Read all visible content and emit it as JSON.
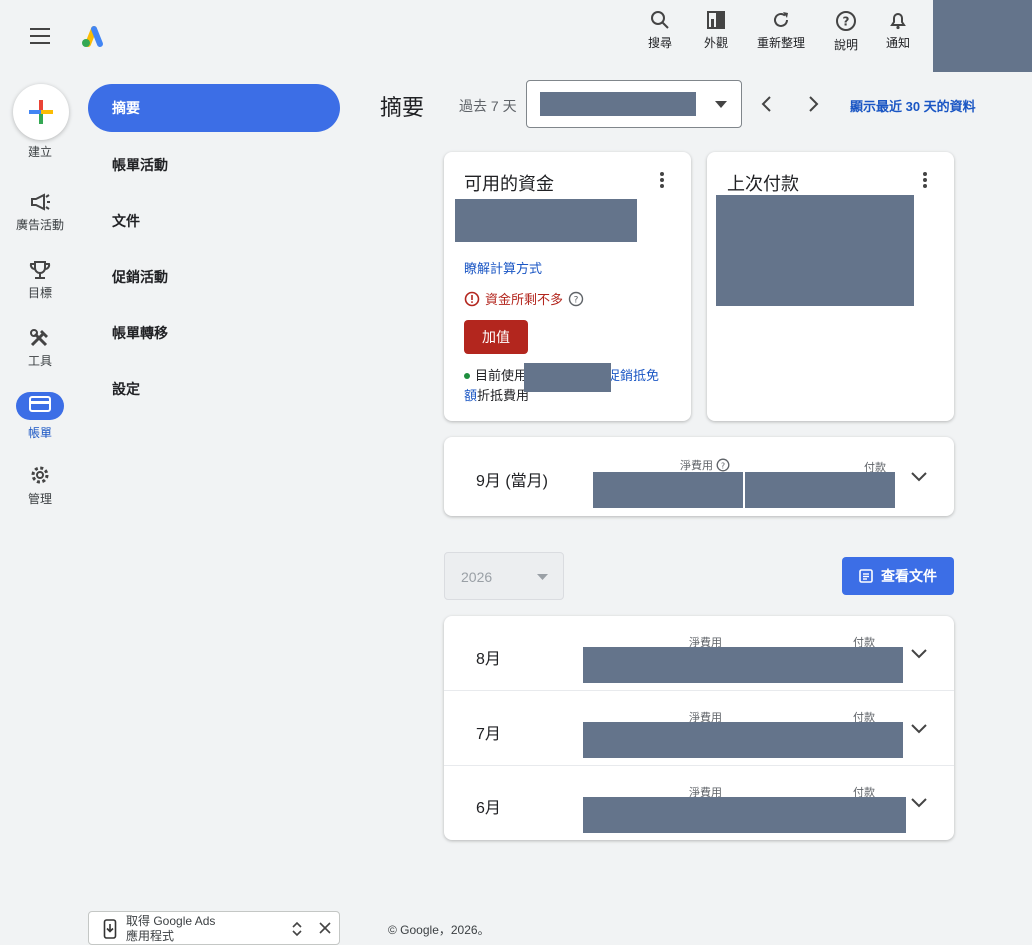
{
  "topbar": {
    "actions": [
      {
        "label": "搜尋",
        "icon": "search-icon"
      },
      {
        "label": "外觀",
        "icon": "appearance-icon"
      },
      {
        "label": "重新整理",
        "icon": "refresh-icon"
      },
      {
        "label": "說明",
        "icon": "help-icon"
      },
      {
        "label": "通知",
        "icon": "bell-icon"
      }
    ]
  },
  "rail": {
    "create": "建立",
    "campaigns": "廣告活動",
    "goals": "目標",
    "tools": "工具",
    "billing": "帳單",
    "admin": "管理"
  },
  "subnav": {
    "items": [
      "摘要",
      "帳單活動",
      "文件",
      "促銷活動",
      "帳單轉移",
      "設定"
    ]
  },
  "header": {
    "title": "摘要",
    "range_label": "過去 7 天",
    "show_30_days": "顯示最近 30 天的資料"
  },
  "funds_card": {
    "title": "可用的資金",
    "learn_link": "瞭解計算方式",
    "warning": "資金所剩不多",
    "add_button": "加值",
    "promo_prefix": "目前使用",
    "promo_link_a": "促銷抵免",
    "promo_link_b": "額",
    "promo_suffix": "折抵費用"
  },
  "last_payment_card": {
    "title": "上次付款"
  },
  "current_month": {
    "label": "9月 (當月)",
    "net_cost_label": "淨費用",
    "payments_label": "付款"
  },
  "year_select": {
    "value": "2026"
  },
  "docs_button": "查看文件",
  "months": [
    {
      "label": "8月",
      "net_cost_label": "淨費用",
      "payments_label": "付款"
    },
    {
      "label": "7月",
      "net_cost_label": "淨費用",
      "payments_label": "付款"
    },
    {
      "label": "6月",
      "net_cost_label": "淨費用",
      "payments_label": "付款"
    }
  ],
  "footer": "© Google，2026。",
  "app_banner": {
    "line1": "取得 Google Ads",
    "line2": "應用程式"
  },
  "colors": {
    "accent": "#3c6ee6",
    "danger": "#b3261e",
    "link": "#1a56c4",
    "redacted": "#64748b"
  }
}
